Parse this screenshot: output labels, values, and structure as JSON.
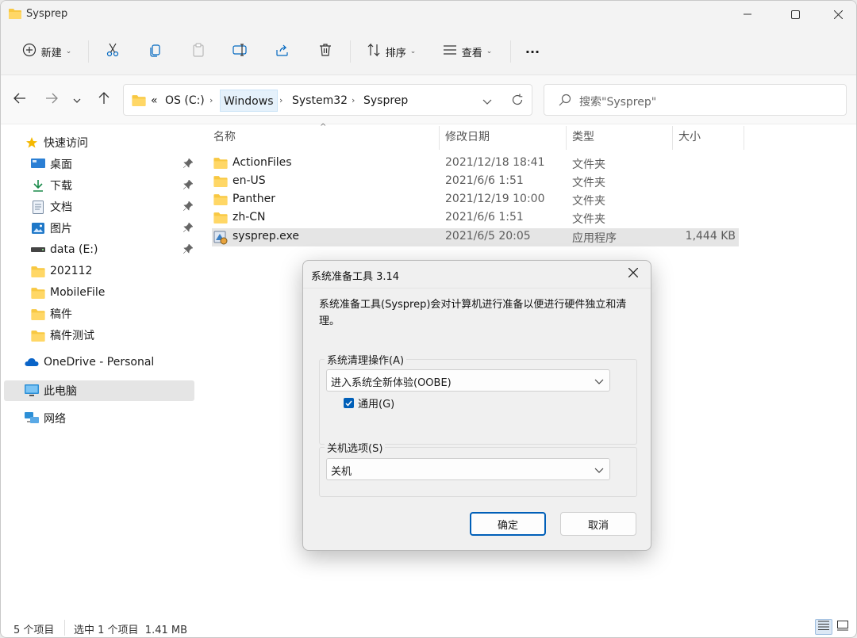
{
  "window": {
    "title": "Sysprep"
  },
  "toolbar": {
    "new_label": "新建",
    "sort_label": "排序",
    "view_label": "查看",
    "more_label": "···"
  },
  "address": {
    "overflow": "«",
    "crumbs": [
      "OS (C:)",
      "Windows",
      "System32",
      "Sysprep"
    ]
  },
  "search": {
    "placeholder": "搜索\"Sysprep\""
  },
  "sidebar": {
    "items": [
      {
        "label": "快速访问",
        "icon": "star-icon"
      },
      {
        "label": "桌面",
        "icon": "desktop-icon",
        "pinned": true
      },
      {
        "label": "下载",
        "icon": "download-icon",
        "pinned": true
      },
      {
        "label": "文档",
        "icon": "document-icon",
        "pinned": true
      },
      {
        "label": "图片",
        "icon": "pictures-icon",
        "pinned": true
      },
      {
        "label": "data (E:)",
        "icon": "drive-icon",
        "pinned": true
      },
      {
        "label": "202112",
        "icon": "folder-icon"
      },
      {
        "label": "MobileFile",
        "icon": "folder-icon"
      },
      {
        "label": "稿件",
        "icon": "folder-icon"
      },
      {
        "label": "稿件测试",
        "icon": "folder-icon"
      },
      {
        "label": "OneDrive - Personal",
        "icon": "cloud-icon"
      },
      {
        "label": "此电脑",
        "icon": "computer-icon",
        "selected": true
      },
      {
        "label": "网络",
        "icon": "network-icon"
      }
    ]
  },
  "columns": {
    "name": "名称",
    "date": "修改日期",
    "type": "类型",
    "size": "大小"
  },
  "files": [
    {
      "name": "ActionFiles",
      "date": "2021/12/18 18:41",
      "type": "文件夹",
      "size": "",
      "icon": "folder-icon"
    },
    {
      "name": "en-US",
      "date": "2021/6/6 1:51",
      "type": "文件夹",
      "size": "",
      "icon": "folder-icon"
    },
    {
      "name": "Panther",
      "date": "2021/12/19 10:00",
      "type": "文件夹",
      "size": "",
      "icon": "folder-icon"
    },
    {
      "name": "zh-CN",
      "date": "2021/6/6 1:51",
      "type": "文件夹",
      "size": "",
      "icon": "folder-icon"
    },
    {
      "name": "sysprep.exe",
      "date": "2021/6/5 20:05",
      "type": "应用程序",
      "size": "1,444 KB",
      "icon": "exe-icon",
      "selected": true
    }
  ],
  "status": {
    "count": "5 个项目",
    "selection": "选中 1 个项目  1.41 MB"
  },
  "dialog": {
    "title": "系统准备工具 3.14",
    "description": "系统准备工具(Sysprep)会对计算机进行准备以便进行硬件独立和清理。",
    "cleanup_group": "系统清理操作(A)",
    "cleanup_value": "进入系统全新体验(OOBE)",
    "generalize_label": "通用(G)",
    "generalize_checked": true,
    "shutdown_group": "关机选项(S)",
    "shutdown_value": "关机",
    "ok_label": "确定",
    "cancel_label": "取消"
  },
  "colors": {
    "accent": "#005fb8",
    "folder": "#f8c842",
    "selection": "#e5e5e5"
  }
}
